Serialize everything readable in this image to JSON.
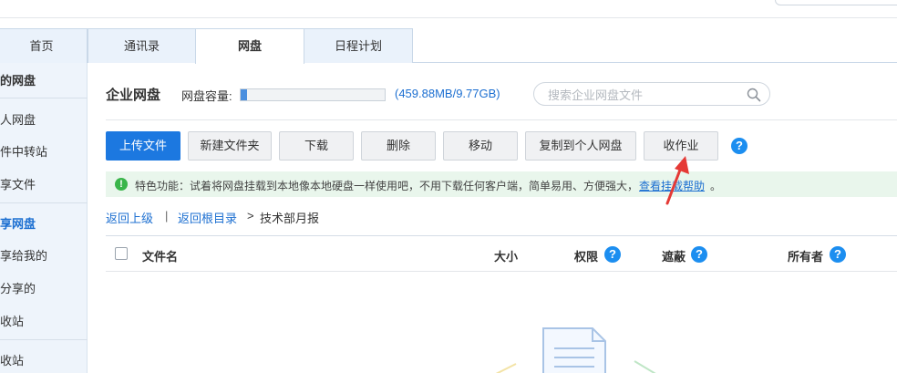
{
  "tabs": [
    {
      "label": "首页"
    },
    {
      "label": "通讯录"
    },
    {
      "label": "网盘"
    },
    {
      "label": "日程计划"
    }
  ],
  "sidebar": {
    "items": [
      {
        "label": "的网盘"
      },
      {
        "label": "人网盘"
      },
      {
        "label": "件中转站"
      },
      {
        "label": "享文件"
      },
      {
        "label": "享网盘"
      },
      {
        "label": "享给我的"
      },
      {
        "label": "分享的"
      },
      {
        "label": "收站"
      },
      {
        "label": "收站"
      }
    ]
  },
  "header": {
    "title": "企业网盘",
    "capacity_label": "网盘容量:",
    "capacity_text": "(459.88MB/9.77GB)",
    "capacity_fraction": 0.046
  },
  "search": {
    "placeholder": "搜索企业网盘文件",
    "value": ""
  },
  "toolbar": {
    "upload": "上传文件",
    "new_folder": "新建文件夹",
    "download": "下载",
    "delete": "删除",
    "move": "移动",
    "copy_personal": "复制到个人网盘",
    "collect_homework": "收作业",
    "help": "?"
  },
  "notice": {
    "icon": "!",
    "text": "特色功能：试着将网盘挂载到本地像本地硬盘一样使用吧，不用下载任何客户端，简单易用、方便强大，",
    "link": "查看挂载帮助",
    "end": "。"
  },
  "breadcrumb": {
    "back_up": "返回上级",
    "sep": "|",
    "back_root": "返回根目录",
    "arrow": ">",
    "current": "技术部月报"
  },
  "table": {
    "columns": {
      "name": "文件名",
      "size": "大小",
      "permission": "权限",
      "hidden": "遮蔽",
      "owner": "所有者"
    },
    "help": "?"
  },
  "colors": {
    "primary": "#1c78e0",
    "link": "#1c6fd1",
    "notice_bg": "#e9f6ec",
    "notice_icon": "#3ab54a",
    "arrow": "#e53935"
  }
}
